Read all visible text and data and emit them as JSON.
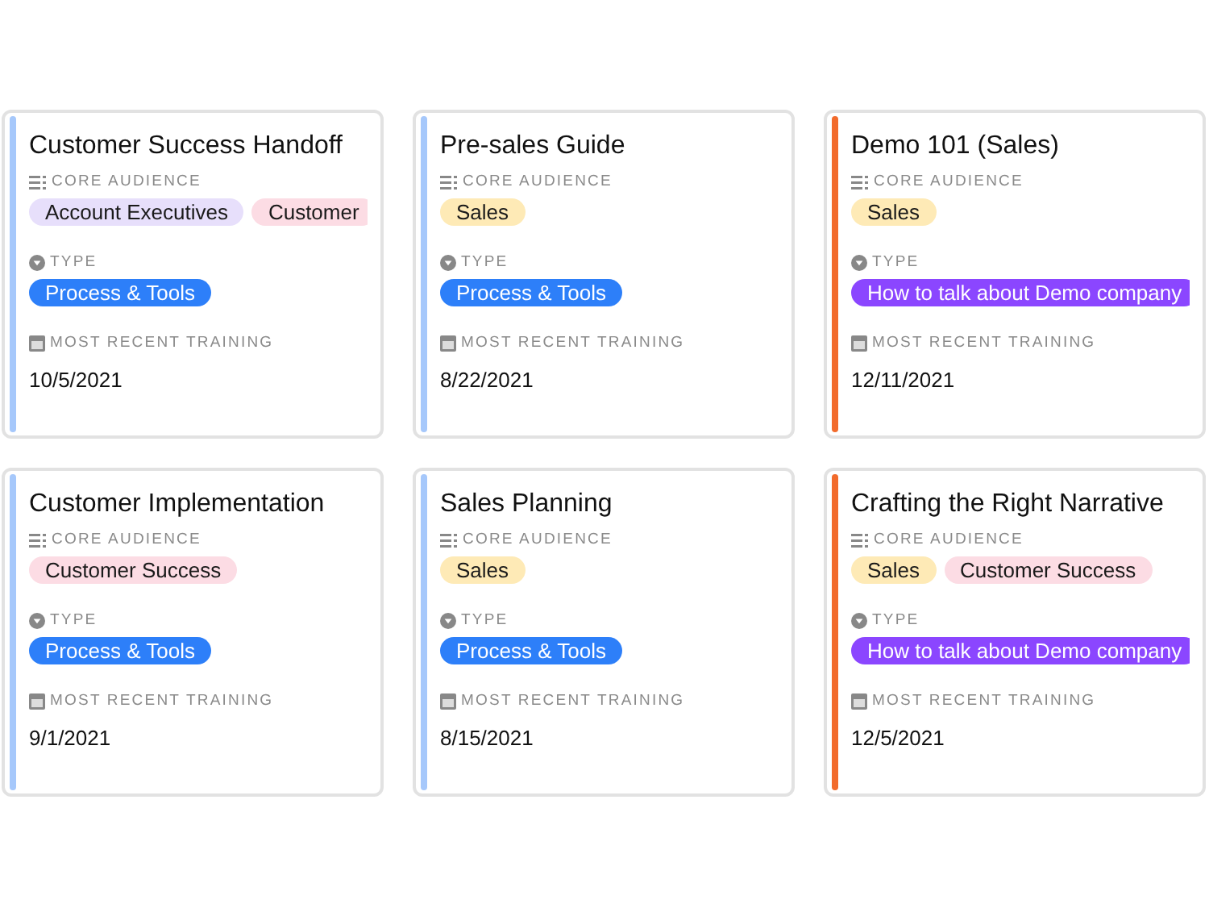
{
  "cards": [
    {
      "title": "Customer Success Handoff",
      "color": "#a6c8fb",
      "audience_label": "CORE AUDIENCE",
      "audience": [
        {
          "label": "Account Executives",
          "color": "#e7dffb"
        },
        {
          "label": "Customer",
          "color": "#fcdce4"
        }
      ],
      "type_label": "TYPE",
      "types": [
        {
          "label": "Process & Tools",
          "color": "#2d7ff9"
        }
      ],
      "training_label": "MOST RECENT TRAINING",
      "training_date": "10/5/2021"
    },
    {
      "title": "Pre-sales Guide",
      "color": "#a6c8fb",
      "audience_label": "CORE AUDIENCE",
      "audience": [
        {
          "label": "Sales",
          "color": "#feeab6"
        }
      ],
      "type_label": "TYPE",
      "types": [
        {
          "label": "Process & Tools",
          "color": "#2d7ff9"
        }
      ],
      "training_label": "MOST RECENT TRAINING",
      "training_date": "8/22/2021"
    },
    {
      "title": "Demo 101 (Sales)",
      "color": "#f26b2c",
      "audience_label": "CORE AUDIENCE",
      "audience": [
        {
          "label": "Sales",
          "color": "#feeab6"
        }
      ],
      "type_label": "TYPE",
      "types": [
        {
          "label": "How to talk about Demo company",
          "color": "#8b46ff"
        }
      ],
      "training_label": "MOST RECENT TRAINING",
      "training_date": "12/11/2021"
    },
    {
      "title": "Customer Implementation",
      "color": "#a6c8fb",
      "audience_label": "CORE AUDIENCE",
      "audience": [
        {
          "label": "Customer Success",
          "color": "#fcdce4"
        }
      ],
      "type_label": "TYPE",
      "types": [
        {
          "label": "Process & Tools",
          "color": "#2d7ff9"
        }
      ],
      "training_label": "MOST RECENT TRAINING",
      "training_date": "9/1/2021"
    },
    {
      "title": "Sales Planning",
      "color": "#a6c8fb",
      "audience_label": "CORE AUDIENCE",
      "audience": [
        {
          "label": "Sales",
          "color": "#feeab6"
        }
      ],
      "type_label": "TYPE",
      "types": [
        {
          "label": "Process & Tools",
          "color": "#2d7ff9"
        }
      ],
      "training_label": "MOST RECENT TRAINING",
      "training_date": "8/15/2021"
    },
    {
      "title": "Crafting the Right Narrative",
      "color": "#f26b2c",
      "audience_label": "CORE AUDIENCE",
      "audience": [
        {
          "label": "Sales",
          "color": "#feeab6"
        },
        {
          "label": "Customer Success",
          "color": "#fcdce4"
        }
      ],
      "type_label": "TYPE",
      "types": [
        {
          "label": "How to talk about Demo company",
          "color": "#8b46ff"
        }
      ],
      "training_label": "MOST RECENT TRAINING",
      "training_date": "12/5/2021"
    }
  ]
}
